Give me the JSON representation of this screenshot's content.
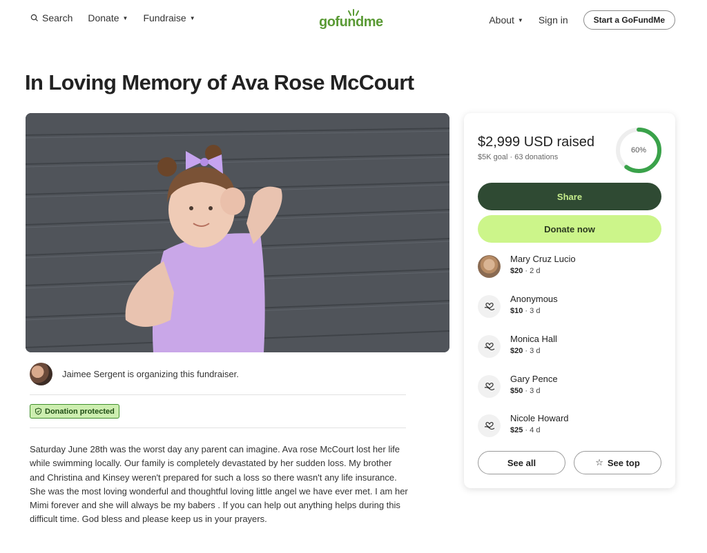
{
  "nav": {
    "search_label": "Search",
    "donate_label": "Donate",
    "fundraise_label": "Fundraise",
    "logo_text": "gofundme",
    "about_label": "About",
    "signin_label": "Sign in",
    "start_label": "Start a GoFundMe"
  },
  "page": {
    "title": "In Loving Memory of Ava Rose McCourt"
  },
  "organizer": {
    "text": "Jaimee Sergent is organizing this fundraiser."
  },
  "badge": {
    "label": "Donation protected"
  },
  "story": {
    "text": "Saturday June 28th was the worst day any parent can imagine. Ava rose McCourt lost her life while swimming locally. Our family is completely devastated by her sudden loss. My brother and Christina and Kinsey weren't prepared for such a loss so there wasn't any life insurance. She was the most loving wonderful and thoughtful loving little angel we have ever met. I am her Mimi forever and she will always be my babers . If you can help out anything helps during this difficult time. God bless and please keep us in your prayers."
  },
  "card": {
    "raised": "$2,999 USD raised",
    "goal": "$5K goal",
    "donations_count": "63 donations",
    "progress_label": "60%",
    "progress_fraction": 0.6,
    "share_label": "Share",
    "donate_label": "Donate now",
    "see_all_label": "See all",
    "see_top_label": "See top",
    "accent_color": "#3aa24a",
    "donors": [
      {
        "name": "Mary Cruz Lucio",
        "amount": "$20",
        "when": "2 d",
        "avatar": "photo"
      },
      {
        "name": "Anonymous",
        "amount": "$10",
        "when": "3 d",
        "avatar": "heart-hand-icon"
      },
      {
        "name": "Monica Hall",
        "amount": "$20",
        "when": "3 d",
        "avatar": "heart-hand-icon"
      },
      {
        "name": "Gary Pence",
        "amount": "$50",
        "when": "3 d",
        "avatar": "heart-hand-icon"
      },
      {
        "name": "Nicole Howard",
        "amount": "$25",
        "when": "4 d",
        "avatar": "heart-hand-icon"
      }
    ]
  }
}
